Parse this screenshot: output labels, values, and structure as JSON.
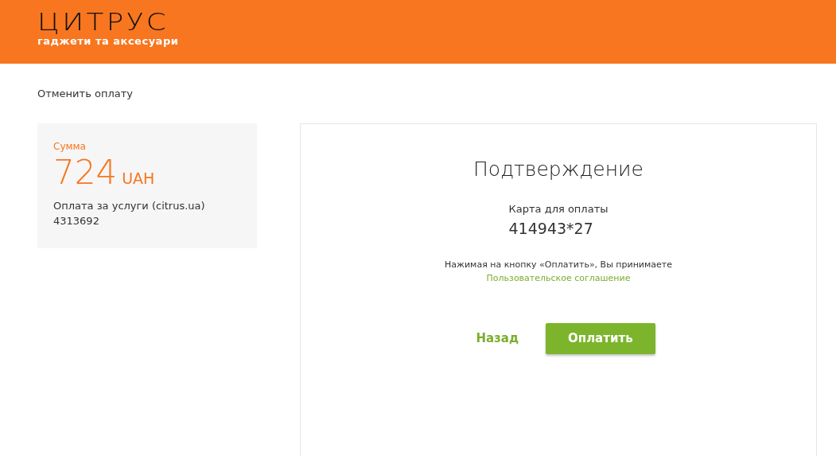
{
  "header": {
    "logo": "ЦИТРУС",
    "tagline": "гаджети та аксесуари"
  },
  "cancel_link": "Отменить оплату",
  "summary": {
    "label": "Сумма",
    "amount": "724",
    "currency": "UAH",
    "description": "Оплата за услуги (citrus.ua)",
    "order": "4313692"
  },
  "confirmation": {
    "title": "Подтверждение",
    "card_label": "Карта для оплаты",
    "card_number": "414943*27",
    "consent_text": "Нажимая на кнопку «Оплатить», Вы принимаете",
    "agreement_link": "Пользовательское соглашение",
    "buttons": [
      {
        "kind": "link",
        "label": "Назад"
      },
      {
        "kind": "primary",
        "label": "Оплатить"
      }
    ]
  }
}
